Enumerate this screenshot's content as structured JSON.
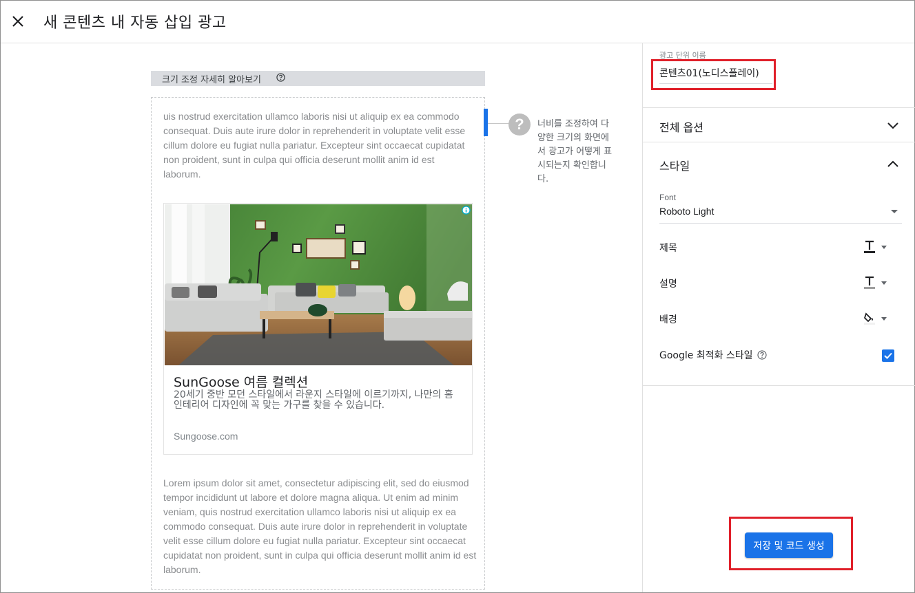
{
  "header": {
    "close_icon": "close-icon",
    "title": "새 콘텐츠 내 자동 삽입 광고"
  },
  "preview": {
    "resize_link": "크기 조정 자세히 알아보기",
    "resize_hint": "너비를 조정하여 다양한 크기의 화면에서 광고가 어떻게 표시되는지 확인합니다.",
    "lorem_top": "uis nostrud exercitation ullamco laboris nisi ut aliquip ex ea commodo consequat. Duis aute irure dolor in reprehenderit in voluptate velit esse cillum dolore eu fugiat nulla pariatur. Excepteur sint occaecat cupidatat non proident, sunt in culpa qui officia deserunt mollit anim id est laborum.",
    "lorem_bottom": "Lorem ipsum dolor sit amet, consectetur adipiscing elit, sed do eiusmod tempor incididunt ut labore et dolore magna aliqua. Ut enim ad minim veniam, quis nostrud exercitation ullamco laboris nisi ut aliquip ex ea commodo consequat. Duis aute irure dolor in reprehenderit in voluptate velit esse cillum dolore eu fugiat nulla pariatur. Excepteur sint occaecat cupidatat non proident, sunt in culpa qui officia deserunt mollit anim id est laborum.",
    "ad": {
      "title": "SunGoose 여름 컬렉션",
      "description": "20세기 중반 모던 스타일에서 라운지 스타일에 이르기까지, 나만의 홈 인테리어 디자인에 꼭 맞는 가구를 찾을 수 있습니다.",
      "url": "Sungoose.com"
    }
  },
  "sidebar": {
    "ad_unit_name_label": "광고 단위 이름",
    "ad_unit_name_value": "콘텐츠01(노디스플레이)",
    "general_options": "전체 옵션",
    "style": "스타일",
    "font_label": "Font",
    "font_value": "Roboto Light",
    "title_label": "제목",
    "description_label": "설명",
    "background_label": "배경",
    "google_optimized": "Google 최적화 스타일",
    "google_optimized_checked": true,
    "save_button": "저장 및 코드 생성"
  },
  "colors": {
    "accent": "#1a73e8",
    "highlight": "#e0202a",
    "wall": "#4f8a3c"
  }
}
